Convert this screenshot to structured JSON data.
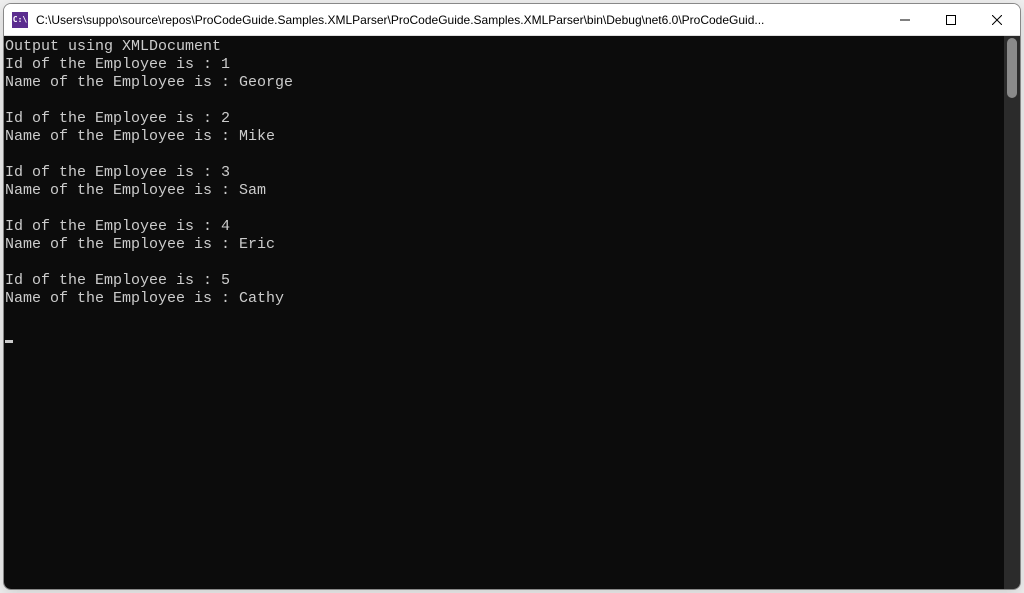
{
  "window": {
    "title": "C:\\Users\\suppo\\source\\repos\\ProCodeGuide.Samples.XMLParser\\ProCodeGuide.Samples.XMLParser\\bin\\Debug\\net6.0\\ProCodeGuid...",
    "icon_label": "C:\\"
  },
  "console": {
    "header": "Output using XMLDocument",
    "id_prefix": "Id of the Employee is : ",
    "name_prefix": "Name of the Employee is : ",
    "employees": [
      {
        "id": "1",
        "name": "George"
      },
      {
        "id": "2",
        "name": "Mike"
      },
      {
        "id": "3",
        "name": "Sam"
      },
      {
        "id": "4",
        "name": "Eric"
      },
      {
        "id": "5",
        "name": "Cathy"
      }
    ]
  }
}
